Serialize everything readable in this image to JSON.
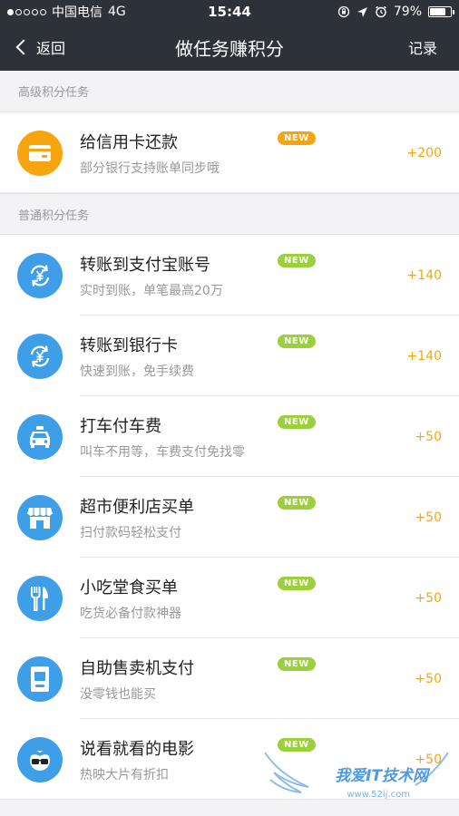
{
  "status_bar": {
    "carrier": "中国电信",
    "network": "4G",
    "time": "15:44",
    "battery": "79%",
    "battery_level": 0.79,
    "signal_bars": 1
  },
  "nav": {
    "back_label": "返回",
    "title": "做任务赚积分",
    "record_label": "记录"
  },
  "sections": {
    "advanced_title": "高级积分任务",
    "normal_title": "普通积分任务"
  },
  "badge_label": "NEW",
  "advanced_tasks": [
    {
      "title": "给信用卡还款",
      "subtitle": "部分银行支持账单同步哦",
      "points": "+200",
      "icon": "credit-card-icon"
    }
  ],
  "normal_tasks": [
    {
      "title": "转账到支付宝账号",
      "subtitle": "实时到账，单笔最高20万",
      "points": "+140",
      "icon": "yuan-transfer-icon"
    },
    {
      "title": "转账到银行卡",
      "subtitle": "快速到账，免手续费",
      "points": "+140",
      "icon": "yuan-transfer-icon"
    },
    {
      "title": "打车付车费",
      "subtitle": "叫车不用等，车费支付免找零",
      "points": "+50",
      "icon": "taxi-icon"
    },
    {
      "title": "超市便利店买单",
      "subtitle": "扫付款码轻松支付",
      "points": "+50",
      "icon": "store-icon"
    },
    {
      "title": "小吃堂食买单",
      "subtitle": "吃货必备付款神器",
      "points": "+50",
      "icon": "fork-knife-icon"
    },
    {
      "title": "自助售卖机支付",
      "subtitle": "没零钱也能买",
      "points": "+50",
      "icon": "vending-machine-icon"
    },
    {
      "title": "说看就看的电影",
      "subtitle": "热映大片有折扣",
      "points": "+50",
      "icon": "glasses-face-icon"
    }
  ],
  "watermark": {
    "text": "我爱IT技术网",
    "url": "www.52ij.com"
  },
  "colors": {
    "nav_bg": "#2d3138",
    "orange": "#f6a50f",
    "blue": "#3f9ee8",
    "green_badge": "#9ccf3c"
  }
}
